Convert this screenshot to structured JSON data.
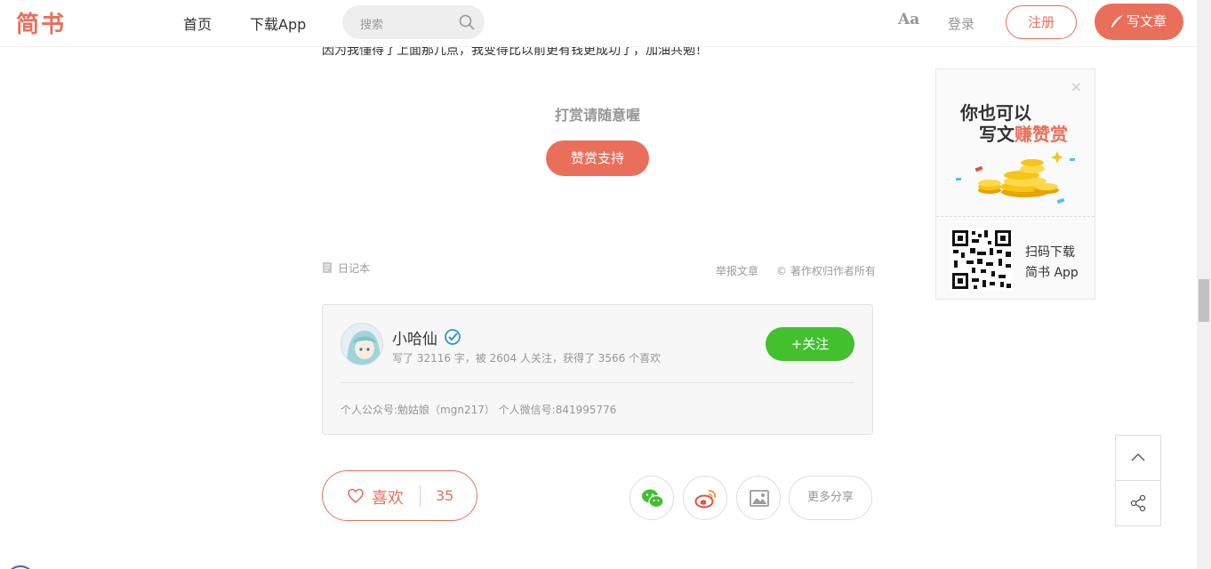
{
  "header": {
    "logo": "简书",
    "nav": {
      "home": "首页",
      "download": "下载App"
    },
    "search_placeholder": "搜索",
    "font_toggle": "Aa",
    "login": "登录",
    "register": "注册",
    "write": "写文章"
  },
  "article": {
    "cut_text": "因为我懂得了上面那几点，我变得比以前更有钱更成功了，加油共勉！",
    "reward_title": "打赏请随意喔",
    "reward_button": "赞赏支持",
    "notebook": "日记本",
    "report": "举报文章",
    "copyright": "© 著作权归作者所有"
  },
  "author": {
    "name": "小哈仙",
    "meta": "写了 32116 字，被 2604 人关注，获得了 3566 个喜欢",
    "follow_button": "关注",
    "intro": "个人公众号:勉姑娘（mgn217） 个人微信号:841995776"
  },
  "actions": {
    "like_label": "喜欢",
    "like_count": "35",
    "more_share": "更多分享"
  },
  "side_ad": {
    "line1": "你也可以",
    "line2_prefix": "写文",
    "line2_highlight": "赚赞赏",
    "qr_text1": "扫码下载",
    "qr_text2": "简书 App"
  },
  "colors": {
    "accent": "#ea6f5a",
    "follow_green": "#42c02e",
    "muted": "#969696"
  }
}
